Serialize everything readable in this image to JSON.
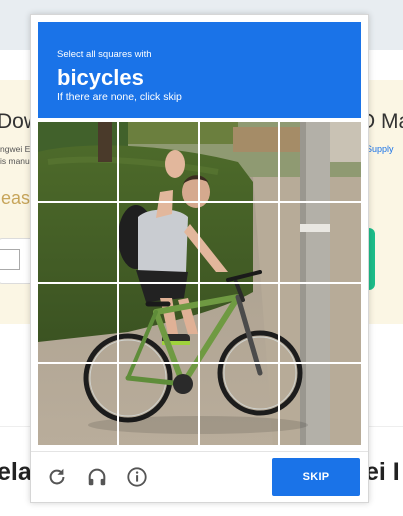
{
  "background": {
    "left_heading": "Dow",
    "left_small_1": "ngwei E",
    "left_small_2": "is manu",
    "left_prompt": "leas",
    "right_heading": "D Ma",
    "right_link": "Supply",
    "bottom_left_heading": "ela",
    "bottom_right_heading": "ei I"
  },
  "captcha": {
    "instruction": "Select all squares with",
    "target": "bicycles",
    "hint": "If there are none, click skip",
    "skip_label": "SKIP",
    "footer_icons": [
      "reload-icon",
      "headphones-icon",
      "info-icon"
    ],
    "grid": {
      "rows": 4,
      "cols": 4
    },
    "colors": {
      "accent": "#1a73e8"
    }
  }
}
